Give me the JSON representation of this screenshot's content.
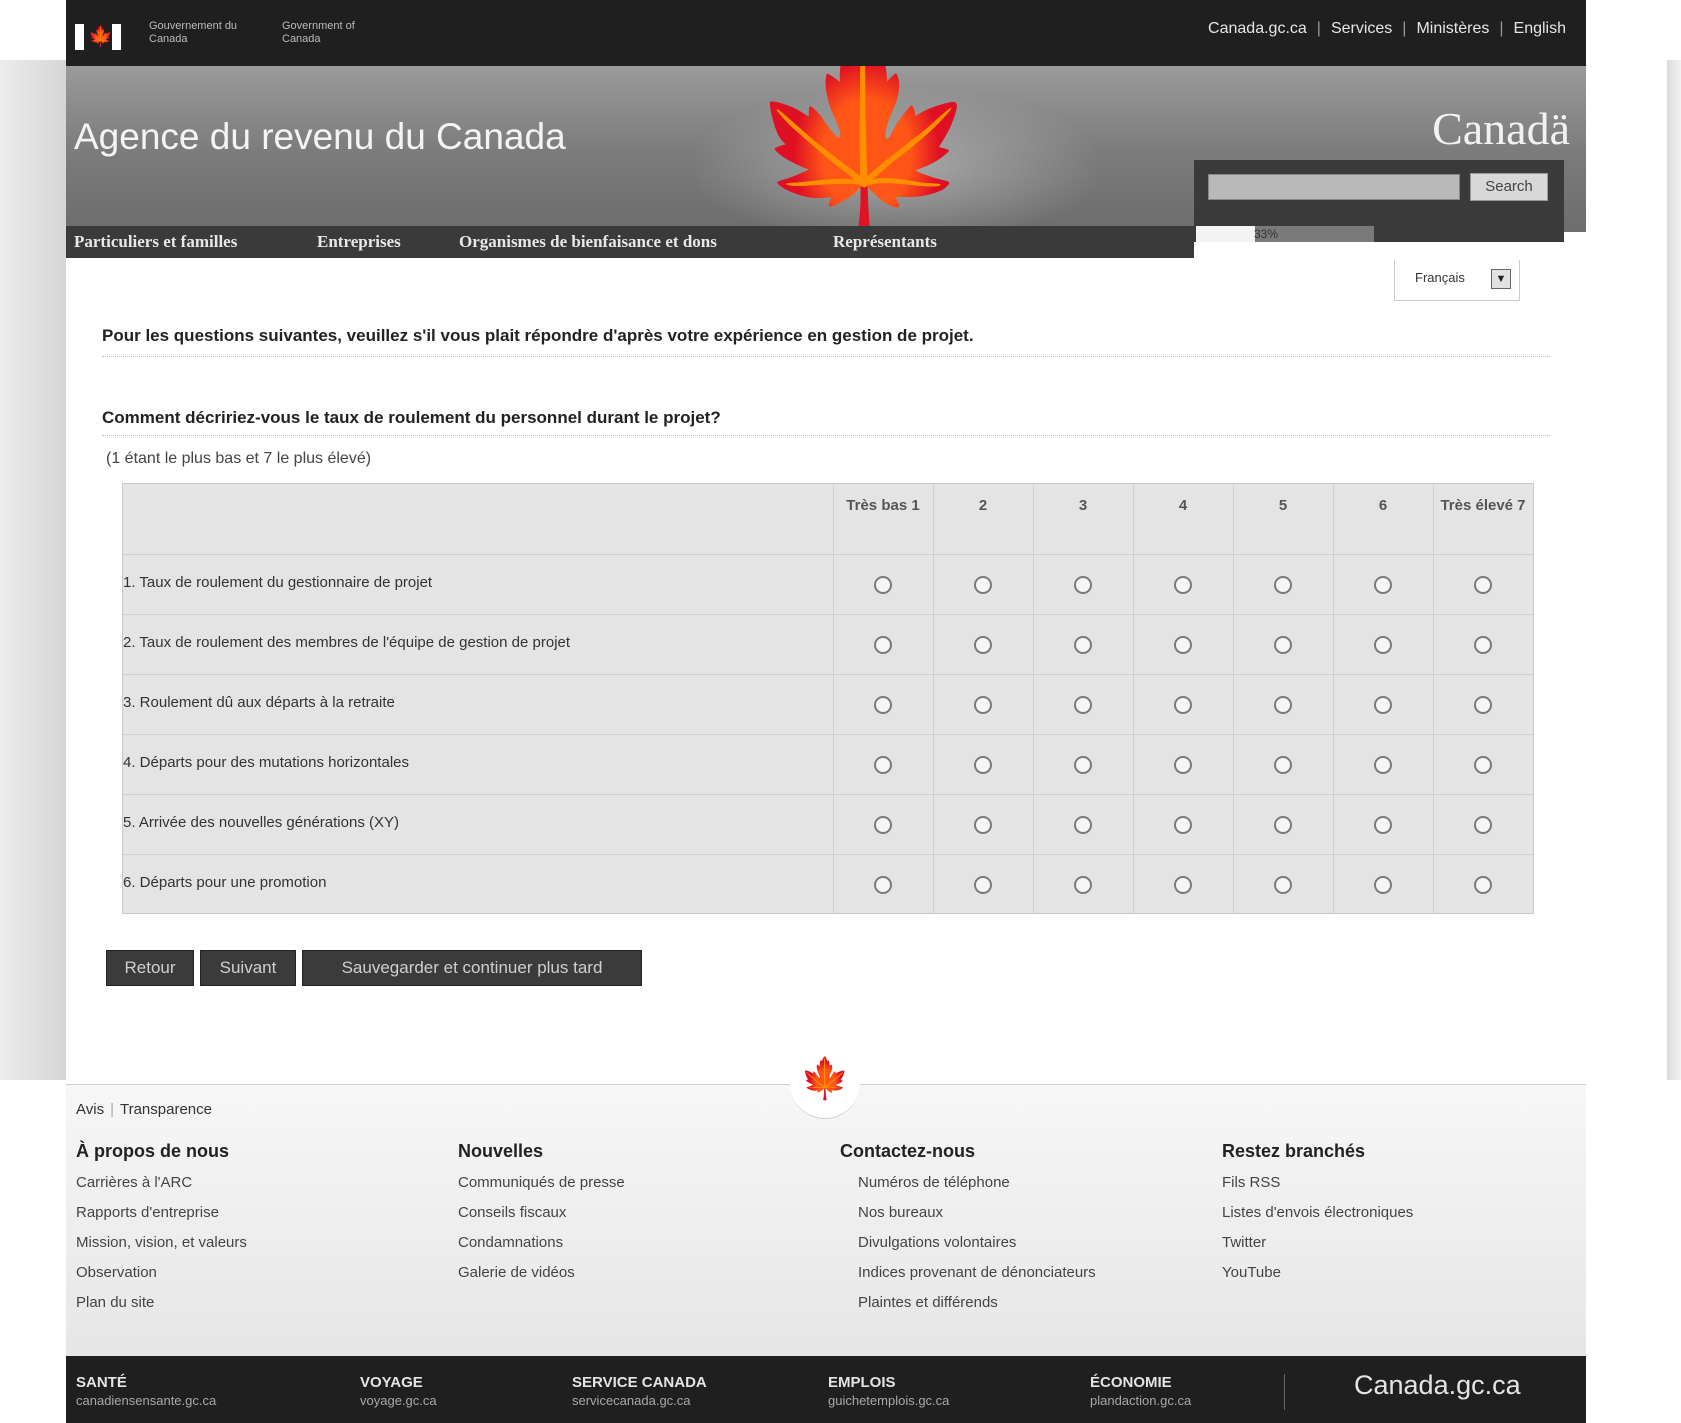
{
  "fip": {
    "gov_fr": "Gouvernement du Canada",
    "gov_en": "Government of Canada",
    "links": [
      "Canada.gc.ca",
      "Services",
      "Ministères",
      "English"
    ]
  },
  "banner": {
    "agency": "Agence du revenu du Canada",
    "wordmark": "Canadä",
    "search_button": "Search",
    "progress_label": "33%",
    "progress_value": 0.33
  },
  "menu": [
    "Particuliers et familles",
    "Entreprises",
    "Organismes de bienfaisance et dons",
    "Représentants"
  ],
  "language": {
    "selected": "Français"
  },
  "survey": {
    "intro": "Pour les questions suivantes, veuillez s'il vous plait répondre d'après votre expérience en gestion de projet.",
    "question": "Comment décririez-vous le taux de roulement du personnel durant le projet?",
    "scale_note": "(1 étant le plus bas et 7 le plus élevé)",
    "columns": [
      "Très bas 1",
      "2",
      "3",
      "4",
      "5",
      "6",
      "Très élevé 7"
    ],
    "rows": [
      "1. Taux de roulement du gestionnaire de projet",
      "2. Taux de roulement des membres de l'équipe de gestion de projet",
      "3. Roulement dû aux départs à la retraite",
      "4. Départs pour des mutations horizontales",
      "5. Arrivée des nouvelles générations (XY)",
      "6. Départs pour une promotion"
    ],
    "buttons": {
      "back": "Retour",
      "next": "Suivant",
      "save": "Sauvegarder et continuer plus tard"
    }
  },
  "footer": {
    "top_links": [
      "Avis",
      "Transparence"
    ],
    "about": {
      "title": "À propos de nous",
      "links": [
        "Carrières à l'ARC",
        "Rapports d'entreprise",
        "Mission, vision, et valeurs",
        "Observation",
        "Plan du site"
      ]
    },
    "news": {
      "title": "Nouvelles",
      "links": [
        "Communiqués de presse",
        "Conseils fiscaux",
        "Condamnations",
        "Galerie de vidéos"
      ]
    },
    "contact": {
      "title": "Contactez-nous",
      "links": [
        "Numéros de téléphone",
        "Nos bureaux",
        "Divulgations volontaires",
        "Indices provenant de dénonciateurs",
        "Plaintes et différends"
      ]
    },
    "connected": {
      "title": "Restez branchés",
      "links": [
        "Fils RSS",
        "Listes d'envois électroniques",
        "Twitter",
        "YouTube"
      ]
    }
  },
  "bottom": {
    "items": [
      {
        "title": "SANTÉ",
        "url": "canadiensensante.gc.ca"
      },
      {
        "title": "VOYAGE",
        "url": "voyage.gc.ca"
      },
      {
        "title": "SERVICE CANADA",
        "url": "servicecanada.gc.ca"
      },
      {
        "title": "EMPLOIS",
        "url": "guichetemplois.gc.ca"
      },
      {
        "title": "ÉCONOMIE",
        "url": "plandaction.gc.ca"
      }
    ],
    "brand": "Canada.gc.ca"
  }
}
